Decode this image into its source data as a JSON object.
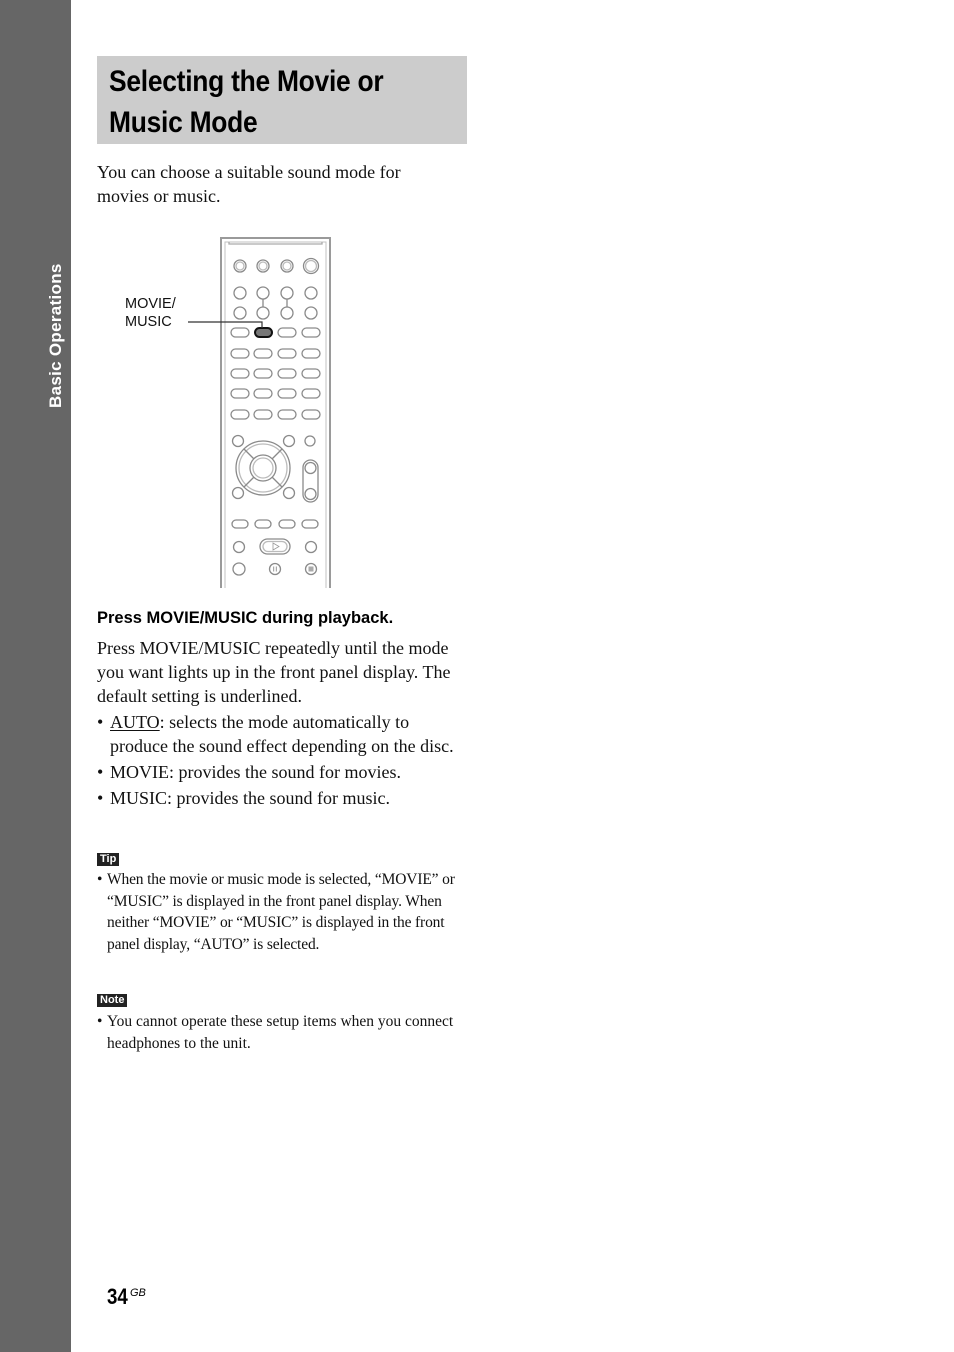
{
  "side_tab": {
    "label": "Basic Operations",
    "color": "#666666"
  },
  "title": "Selecting the Movie or Music Mode",
  "intro": "You can choose a suitable sound mode for movies or music.",
  "figure": {
    "callout_label_line1": "MOVIE/",
    "callout_label_line2": "MUSIC",
    "highlighted_button": "MOVIE/MUSIC"
  },
  "step": {
    "heading": "Press MOVIE/MUSIC during playback.",
    "body": "Press MOVIE/MUSIC repeatedly until the mode you want lights up in the front panel display. The default setting is underlined.",
    "options": [
      {
        "name": "AUTO",
        "underlined": true,
        "desc": ": selects the mode automatically to produce the sound effect depending on the disc."
      },
      {
        "name": "MOVIE",
        "underlined": false,
        "desc": ": provides the sound for movies."
      },
      {
        "name": "MUSIC",
        "underlined": false,
        "desc": ": provides the sound for music."
      }
    ]
  },
  "tip": {
    "label": "Tip",
    "items": [
      "When the movie or music mode is selected, “MOVIE” or “MUSIC” is displayed in the front panel display. When neither “MOVIE” or “MUSIC” is displayed in the front panel display, “AUTO” is selected."
    ]
  },
  "note": {
    "label": "Note",
    "items": [
      "You cannot operate these setup items when you connect headphones to the unit."
    ]
  },
  "bullet_char": "•",
  "page": {
    "number": "34",
    "suffix": "GB"
  }
}
